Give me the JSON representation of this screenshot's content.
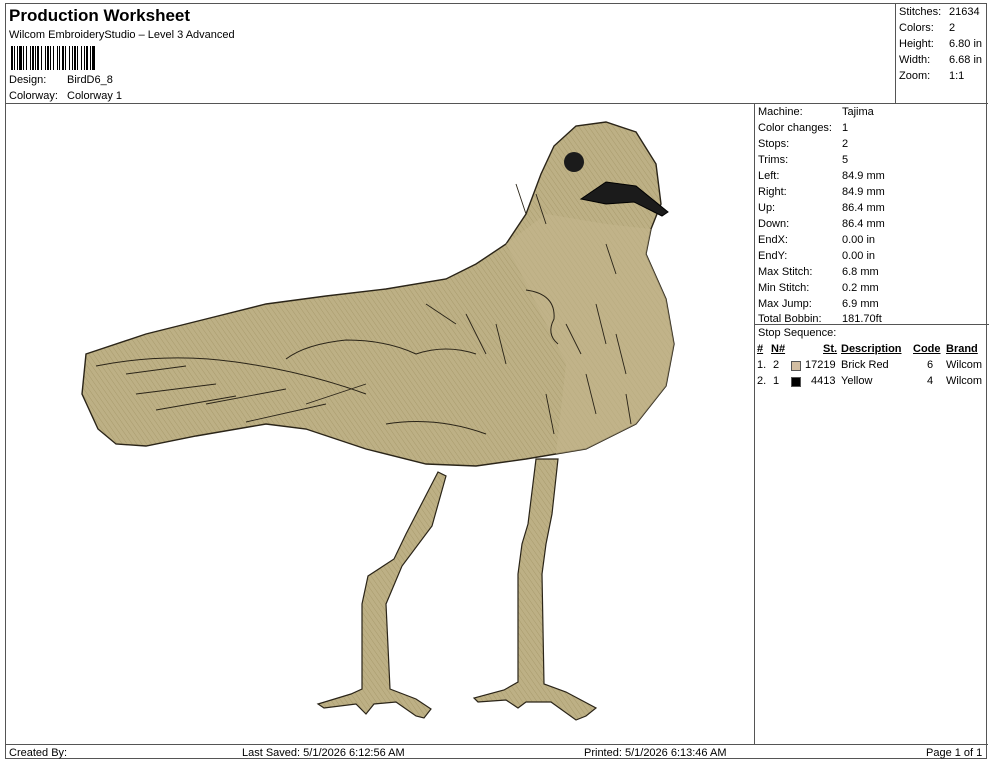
{
  "header": {
    "title": "Production Worksheet",
    "subtitle": "Wilcom EmbroideryStudio – Level 3 Advanced",
    "design_label": "Design:",
    "design_value": "BirdD6_8",
    "colorway_label": "Colorway:",
    "colorway_value": "Colorway 1"
  },
  "stats": [
    {
      "label": "Stitches:",
      "value": "21634"
    },
    {
      "label": "Colors:",
      "value": "2"
    },
    {
      "label": "Height:",
      "value": "6.80 in"
    },
    {
      "label": "Width:",
      "value": "6.68 in"
    },
    {
      "label": "Zoom:",
      "value": "1:1"
    }
  ],
  "machine_info": [
    {
      "label": "Machine:",
      "value": "Tajima"
    },
    {
      "label": "Color changes:",
      "value": "1"
    },
    {
      "label": "Stops:",
      "value": "2"
    },
    {
      "label": "Trims:",
      "value": "5"
    },
    {
      "label": "Left:",
      "value": "84.9 mm"
    },
    {
      "label": "Right:",
      "value": "84.9 mm"
    },
    {
      "label": "Up:",
      "value": "86.4 mm"
    },
    {
      "label": "Down:",
      "value": "86.4 mm"
    },
    {
      "label": "EndX:",
      "value": "0.00 in"
    },
    {
      "label": "EndY:",
      "value": "0.00 in"
    },
    {
      "label": "Max Stitch:",
      "value": "6.8 mm"
    },
    {
      "label": "Min Stitch:",
      "value": "0.2 mm"
    },
    {
      "label": "Max Jump:",
      "value": "6.9 mm"
    },
    {
      "label": "Total Bobbin:",
      "value": "181.70ft"
    }
  ],
  "stop_sequence": {
    "title": "Stop Sequence:",
    "headers": {
      "num": "#",
      "n": "N#",
      "st": "St.",
      "description": "Description",
      "code": "Code",
      "brand": "Brand"
    },
    "rows": [
      {
        "num": "1.",
        "n": "2",
        "swatch": "#d3bea2",
        "st": "17219",
        "description": "Brick Red",
        "code": "6",
        "brand": "Wilcom"
      },
      {
        "num": "2.",
        "n": "1",
        "swatch": "#000000",
        "st": "4413",
        "description": "Yellow",
        "code": "4",
        "brand": "Wilcom"
      }
    ]
  },
  "footer": {
    "created_by": "Created By:",
    "last_saved": "Last Saved: 5/1/2026 6:12:56 AM",
    "printed": "Printed: 5/1/2026 6:13:46 AM",
    "page": "Page 1 of 1"
  },
  "design_colors": {
    "fill": "#bdb085",
    "outline": "#2a2418",
    "beak": "#1b1b1b"
  }
}
